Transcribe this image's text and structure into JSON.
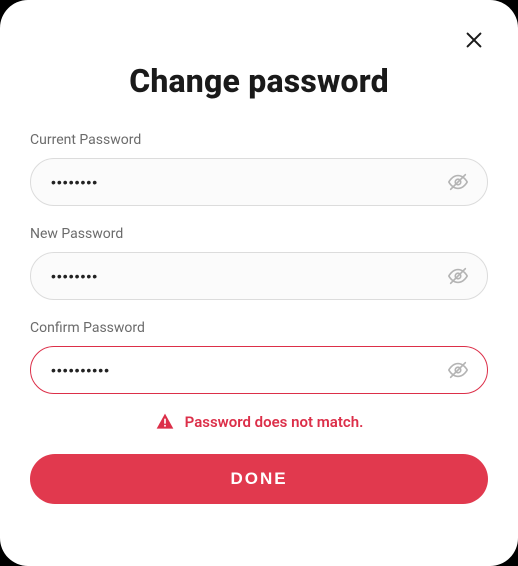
{
  "dialog": {
    "title": "Change password",
    "fields": {
      "current": {
        "label": "Current Password",
        "value": "••••••••"
      },
      "new": {
        "label": "New Password",
        "value": "••••••••"
      },
      "confirm": {
        "label": "Confirm Password",
        "value": "••••••••••"
      }
    },
    "error_message": "Password does not match.",
    "done_label": "DONE"
  },
  "colors": {
    "accent": "#e1394e",
    "error": "#dc2f49",
    "border": "#dcdcdc",
    "label": "#6b6b6b"
  },
  "icons": {
    "close": "close-icon",
    "eye_off": "eye-off-icon",
    "alert": "alert-triangle-icon"
  }
}
